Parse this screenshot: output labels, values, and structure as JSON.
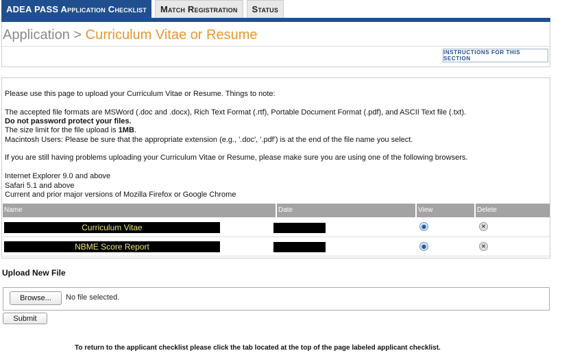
{
  "tabs": [
    {
      "label": "ADEA PASS Application Checklist",
      "active": true
    },
    {
      "label": "Match Registration",
      "active": false
    },
    {
      "label": "Status",
      "active": false
    }
  ],
  "breadcrumb": {
    "root": "Application",
    "separator": ">",
    "current": "Curriculum Vitae or Resume"
  },
  "instructions_button": "INSTRUCTIONS FOR THIS SECTION",
  "content": {
    "intro": "Please use this page to upload your Curriculum Vitae or Resume. Things to note:",
    "formats": "The accepted file formats are MSWord (.doc and .docx), Rich Text Format (.rtf), Portable Document Format (.pdf), and ASCII Text file (.txt).",
    "no_password": "Do not password protect your files.",
    "size_prefix": "The size limit for the file upload is ",
    "size_value": "1MB",
    "size_suffix": ".",
    "mac_note": "Macintosh Users: Please be sure that the appropriate extension (e.g., '.doc', '.pdf') is at the end of the file name you select.",
    "browsers_intro": "If you are still having problems uploading your Curriculum Vitae or Resume, please make sure you are using one of the following browsers.",
    "browsers": [
      "Internet Explorer 9.0 and above",
      "Safari 5.1 and above",
      "Current and prior major versions of Mozilla Firefox or Google Chrome"
    ]
  },
  "table": {
    "headers": [
      "Name",
      "Date",
      "View",
      "Delete"
    ],
    "rows": [
      {
        "name": "Curriculum Vitae",
        "date": ""
      },
      {
        "name": "NBME Score Report",
        "date": ""
      }
    ]
  },
  "upload": {
    "title": "Upload New File",
    "browse_label": "Browse...",
    "no_file_text": "No file selected.",
    "submit_label": "Submit"
  },
  "footer": "To return to the applicant checklist please click the tab located at the top of the page labeled applicant checklist.",
  "colors": {
    "tab_active": "#1f4f8f",
    "accent_orange": "#e8962e",
    "table_header": "#a3a3a3"
  }
}
